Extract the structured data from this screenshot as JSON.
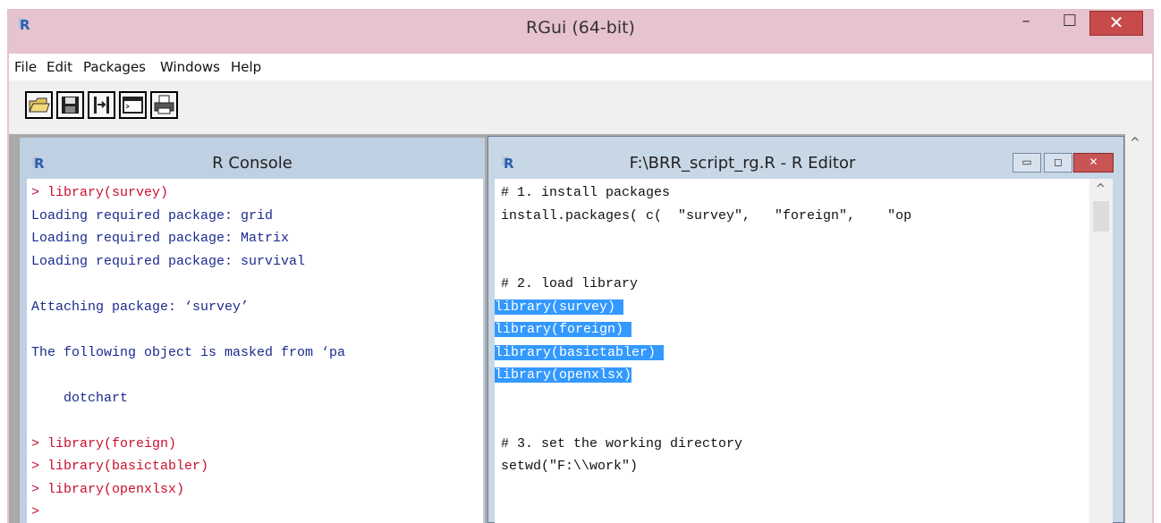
{
  "window": {
    "title": "RGui (64-bit)",
    "logo": "R",
    "controls": {
      "minimize": "–",
      "maximize": "☐",
      "close": "✕"
    }
  },
  "menu": [
    "File",
    "Edit",
    "Packages",
    "Windows",
    "Help"
  ],
  "toolbar": [
    "open-script-icon",
    "save-icon",
    "load-workspace-icon",
    "console-icon",
    "print-icon"
  ],
  "console": {
    "logo": "R",
    "title": "R Console",
    "lines": [
      {
        "text": "> library(survey)",
        "kind": "input"
      },
      {
        "text": "Loading required package: grid",
        "kind": "output"
      },
      {
        "text": "Loading required package: Matrix",
        "kind": "output"
      },
      {
        "text": "Loading required package: survival",
        "kind": "output"
      },
      {
        "text": "",
        "kind": "output"
      },
      {
        "text": "Attaching package: ‘survey’",
        "kind": "output"
      },
      {
        "text": "",
        "kind": "output"
      },
      {
        "text": "The following object is masked from ‘pa",
        "kind": "output"
      },
      {
        "text": "",
        "kind": "output"
      },
      {
        "text": "    dotchart",
        "kind": "output"
      },
      {
        "text": "",
        "kind": "output"
      },
      {
        "text": "> library(foreign)",
        "kind": "input"
      },
      {
        "text": "> library(basictabler)",
        "kind": "input"
      },
      {
        "text": "> library(openxlsx)",
        "kind": "input"
      },
      {
        "text": ">",
        "kind": "input"
      }
    ]
  },
  "editor": {
    "logo": "R",
    "title": "F:\\BRR_script_rg.R - R Editor",
    "controls": {
      "minimize": "▭",
      "maximize": "◻",
      "close": "✕"
    },
    "lines": [
      {
        "text": "# 1. install packages",
        "selected": false
      },
      {
        "text": "install.packages( c(  \"survey\",   \"foreign\",    \"op",
        "selected": false
      },
      {
        "text": "",
        "selected": false
      },
      {
        "text": "",
        "selected": false
      },
      {
        "text": "# 2. load library",
        "selected": false
      },
      {
        "text": "library(survey) ",
        "selected": true
      },
      {
        "text": "library(foreign) ",
        "selected": true
      },
      {
        "text": "library(basictabler) ",
        "selected": true
      },
      {
        "text": "library(openxlsx)",
        "selected": true
      },
      {
        "text": "",
        "selected": false
      },
      {
        "text": "",
        "selected": false
      },
      {
        "text": "# 3. set the working directory",
        "selected": false
      },
      {
        "text": "setwd(\"F:\\\\work\")",
        "selected": false
      }
    ]
  },
  "scroll_arrows": {
    "up": "^"
  }
}
